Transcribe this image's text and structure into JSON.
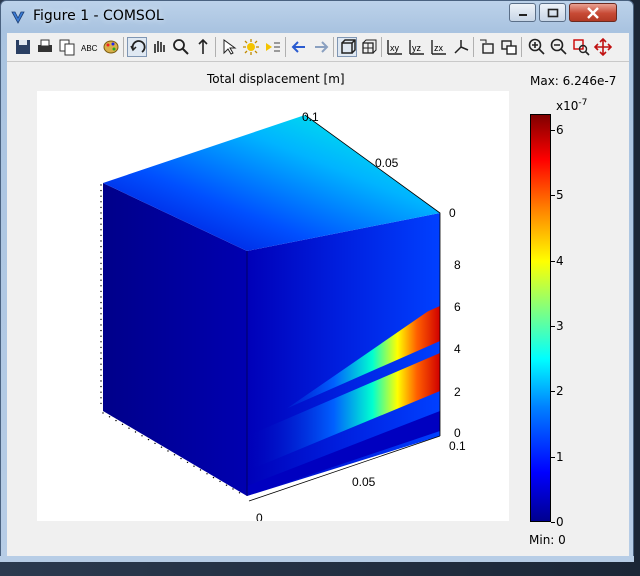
{
  "window": {
    "title": "Figure 1 - COMSOL"
  },
  "toolbar": {
    "buttons": [
      {
        "icon": "save-icon"
      },
      {
        "icon": "print-icon"
      },
      {
        "icon": "copy-icon"
      },
      {
        "icon": "abc-text-icon"
      },
      {
        "icon": "palette-icon"
      },
      {
        "icon": "rotate-icon",
        "pressed": true
      },
      {
        "icon": "pan-icon"
      },
      {
        "icon": "zoom-icon"
      },
      {
        "icon": "scroll-icon"
      },
      {
        "icon": "select-icon"
      },
      {
        "icon": "light-icon"
      },
      {
        "icon": "headlight-icon"
      },
      {
        "icon": "arrow-left-icon"
      },
      {
        "icon": "arrow-right-icon"
      },
      {
        "icon": "axis-box-icon",
        "pressed": true
      },
      {
        "icon": "grid-box-icon"
      },
      {
        "icon": "xy-view-icon",
        "text": "xy"
      },
      {
        "icon": "yz-view-icon",
        "text": "yz"
      },
      {
        "icon": "zx-view-icon",
        "text": "zx"
      },
      {
        "icon": "iso-view-icon"
      },
      {
        "icon": "camera-icon"
      },
      {
        "icon": "camera2-icon"
      },
      {
        "icon": "zoom-in-icon"
      },
      {
        "icon": "zoom-out-icon"
      },
      {
        "icon": "zoom-window-icon"
      },
      {
        "icon": "zoom-extents-icon"
      }
    ]
  },
  "plot": {
    "title": "Total displacement [m]",
    "max_label": "Max: 6.246e-7",
    "min_label": "Min: 0",
    "colorbar": {
      "exponent_base": "x10",
      "exponent": "-7",
      "ticks": [
        "0",
        "1",
        "2",
        "3",
        "4",
        "5",
        "6"
      ],
      "min_value": 0,
      "max_value": 6.246e-07,
      "colormap": "jet"
    },
    "axis_ticks": {
      "top_depth": [
        "0.1",
        "0.05",
        "0"
      ],
      "vertical": [
        "8",
        "6",
        "4",
        "2",
        "0"
      ],
      "bottom_x": [
        "0.1",
        "0.05",
        "0"
      ]
    }
  }
}
